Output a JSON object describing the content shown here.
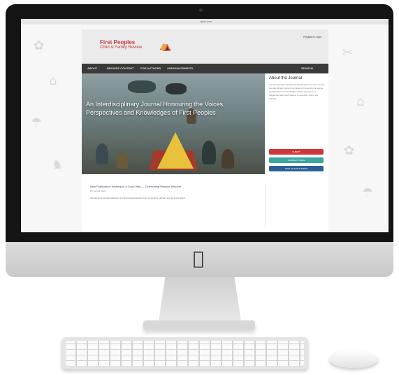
{
  "browser": {
    "url": "fpcfr.com"
  },
  "site": {
    "logo_line1": "First Peoples",
    "logo_line2": "Child & Family Review",
    "header_links": "Register   Login",
    "nav": [
      "ABOUT",
      "BROWSE CONTENT",
      "FOR AUTHORS",
      "ANNOUNCEMENTS",
      "SEARCH"
    ],
    "hero_title": "An Interdisciplinary Journal Honouring the Voices, Perspectives and Knowledges of First Peoples",
    "sidebar_title": "About the Journal",
    "sidebar_text": "The First Peoples Child & Family Review is an open-access, interdisciplinary journal committed to honouring the voices, perspectives and knowledges of First peoples and Indigenous allies with respect to research, policy and practice.",
    "buttons": [
      {
        "label": "SUBMIT",
        "color": "#d0353a"
      },
      {
        "label": "CURRENT ISSUE",
        "color": "#3aa6a0"
      },
      {
        "label": "SIGN UP FOR E-NEWS",
        "color": "#2e5f94"
      }
    ],
    "article_title": "New Publication: Walking in a Good Way — Celebrating Practice Wisdom",
    "article_meta": "By Journal Team",
    "article_text": "Introducing a special collection of practice-based articles from community partners across Turtle Island."
  },
  "device": {
    "brand_icon": "apple-logo"
  }
}
